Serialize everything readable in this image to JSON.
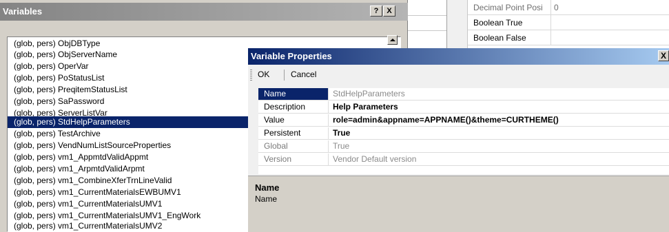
{
  "bg_grid": {
    "rows": [
      {
        "name": "Decimal Point Posi",
        "value": "0"
      },
      {
        "name": "Boolean True",
        "value": ""
      },
      {
        "name": "Boolean False",
        "value": ""
      }
    ]
  },
  "variables_window": {
    "title": "Variables",
    "help_button": "?",
    "close_button": "X",
    "items": [
      "(glob, pers) ObjDBType",
      "(glob, pers) ObjServerName",
      "(glob, pers) OperVar",
      "(glob, pers) PoStatusList",
      "(glob, pers) PreqitemStatusList",
      "(glob, pers) SaPassword",
      "(glob, pers) ServerListVar",
      "(glob, pers) StdHelpParameters",
      "(glob, pers) TestArchive",
      "(glob, pers) VendNumListSourceProperties",
      "(glob, pers) vm1_AppmtdValidAppmt",
      "(glob, pers) vm1_ArpmtdValidArpmt",
      "(glob, pers) vm1_CombineXferTrnLineValid",
      "(glob, pers) vm1_CurrentMaterialsEWBUMV1",
      "(glob, pers) vm1_CurrentMaterialsUMV1",
      "(glob, pers) vm1_CurrentMaterialsUMV1_EngWork",
      "(glob, pers) vm1_CurrentMaterialsUMV2"
    ],
    "selected_index": 7
  },
  "properties_dialog": {
    "title": "Variable Properties",
    "close_button": "X",
    "toolbar": {
      "ok": "OK",
      "cancel": "Cancel"
    },
    "rows": [
      {
        "name": "Name",
        "value": "StdHelpParameters"
      },
      {
        "name": "Description",
        "value": "Help Parameters"
      },
      {
        "name": "Value",
        "value": "role=admin&appname=APPNAME()&theme=CURTHEME()"
      },
      {
        "name": "Persistent",
        "value": "True"
      },
      {
        "name": "Global",
        "value": "True"
      },
      {
        "name": "Version",
        "value": "Vendor Default version"
      }
    ],
    "description": {
      "heading": "Name",
      "body": "Name"
    }
  },
  "colors": {
    "selection": "#0a246a",
    "dialog_title_gradient_start": "#0a246a",
    "inactive_title": "#848484",
    "face": "#d4d0c8"
  }
}
